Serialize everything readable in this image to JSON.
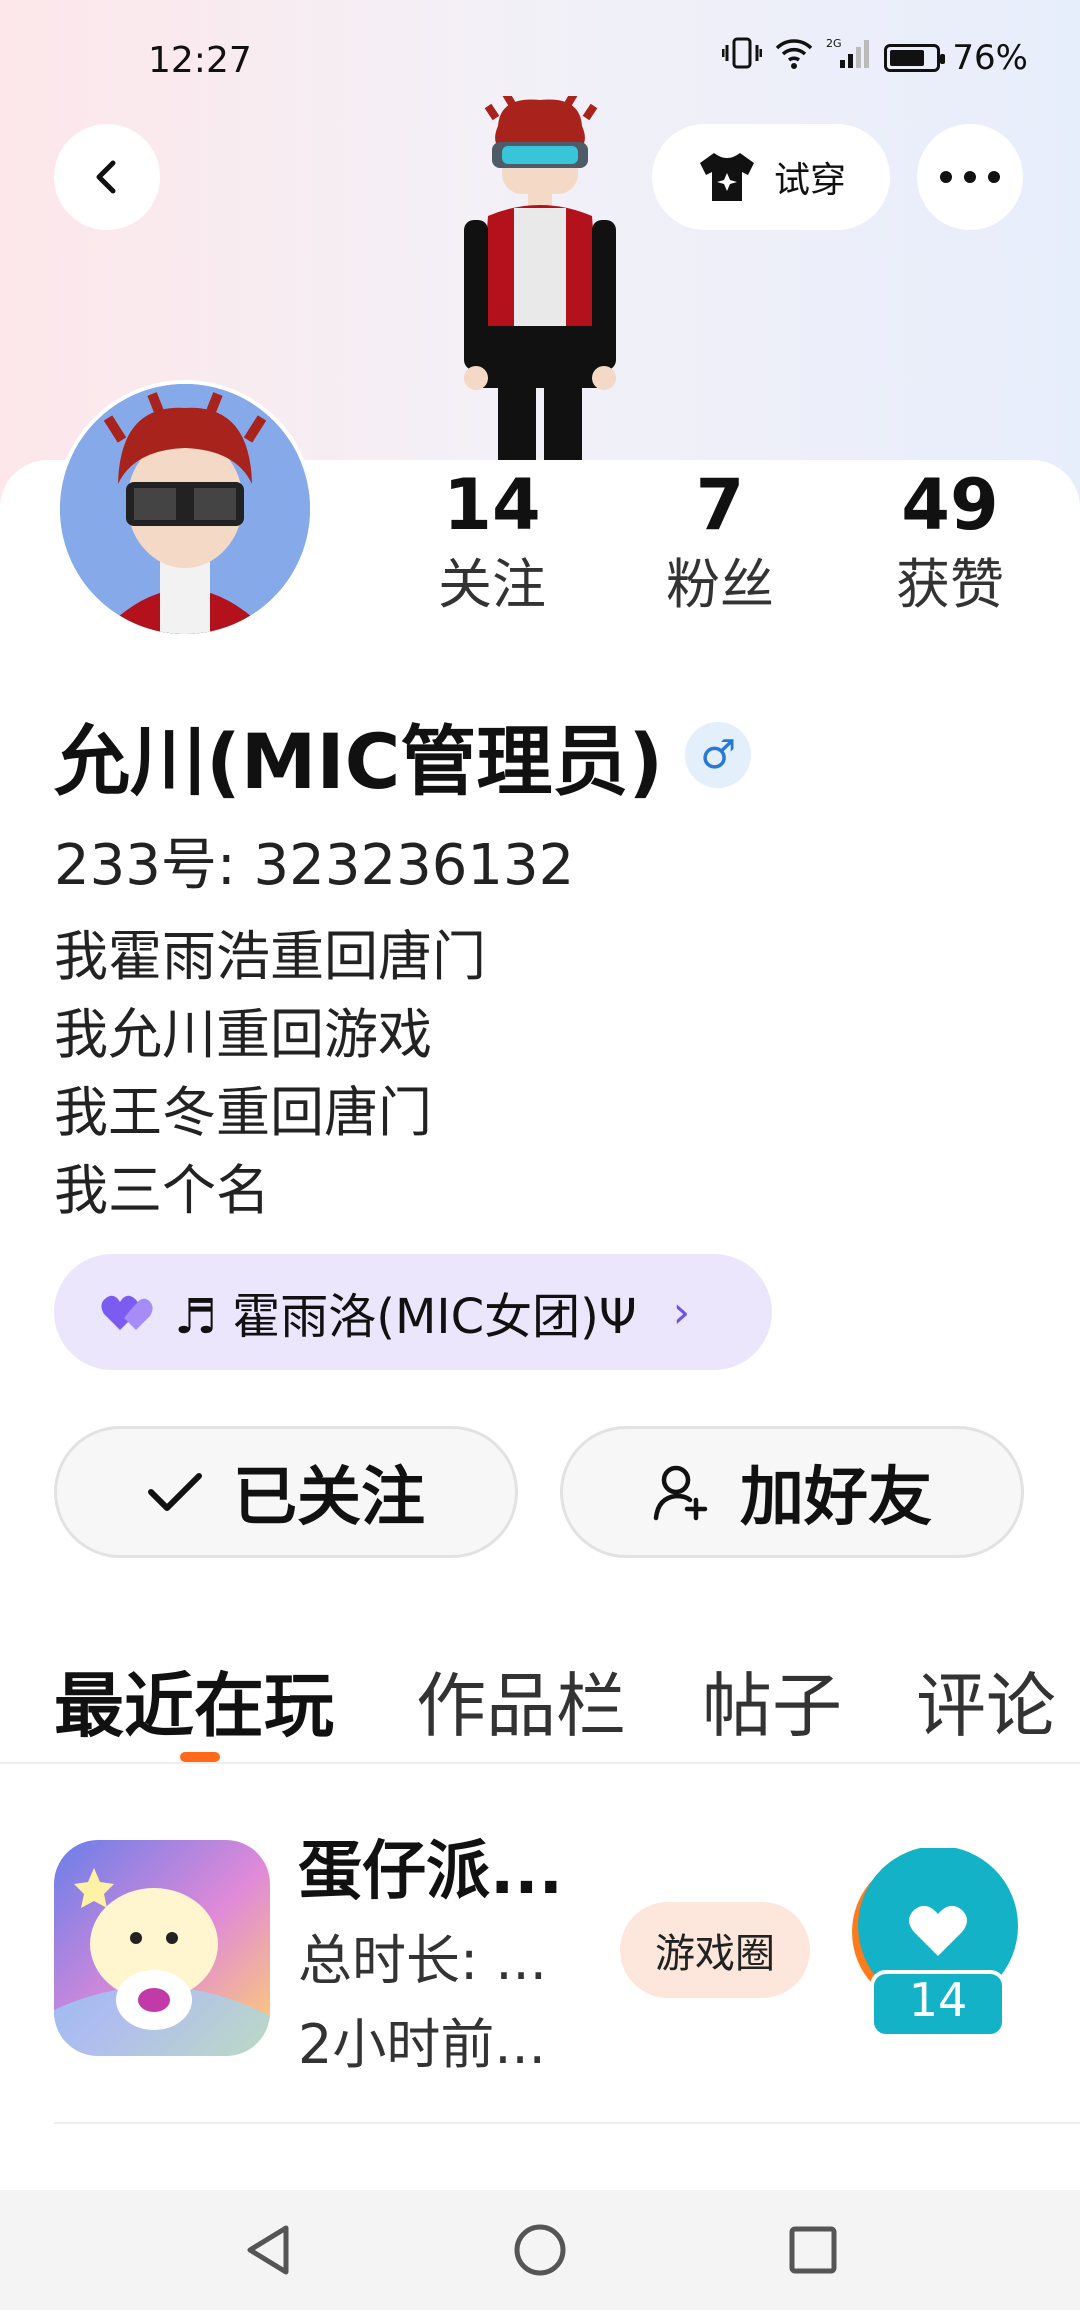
{
  "status_bar": {
    "time": "12:27",
    "battery_percent": "76%",
    "battery_level": 0.76,
    "network": "2G"
  },
  "header": {
    "try_on_label": "试穿"
  },
  "stats": [
    {
      "value": "14",
      "label": "关注"
    },
    {
      "value": "7",
      "label": "粉丝"
    },
    {
      "value": "49",
      "label": "获赞"
    }
  ],
  "profile": {
    "nickname": "允川(MIC管理员)",
    "gender_symbol": "♂",
    "uid": "233号: 323236132",
    "bio": [
      "我霍雨浩重回唐门",
      "我允川重回游戏",
      "我王冬重回唐门",
      "我三个名"
    ]
  },
  "relationship_pill": {
    "text": "♬ 霍雨洛(MIC女团)Ψ",
    "chevron": "›"
  },
  "actions": {
    "followed": "已关注",
    "add_friend": "加好友"
  },
  "tabs": [
    {
      "label": "最近在玩",
      "active": true
    },
    {
      "label": "作品栏",
      "active": false
    },
    {
      "label": "帖子",
      "active": false
    },
    {
      "label": "评论",
      "active": false
    }
  ],
  "games": [
    {
      "title": "蛋仔派...",
      "total_time": "总时长: ...",
      "last_played": "2小时前...",
      "tag": "游戏圈",
      "likes": "14"
    }
  ],
  "colors": {
    "accent_orange": "#ff6a1a",
    "like_teal": "#13b2c6",
    "pill_bg": "#ebe6fb"
  }
}
